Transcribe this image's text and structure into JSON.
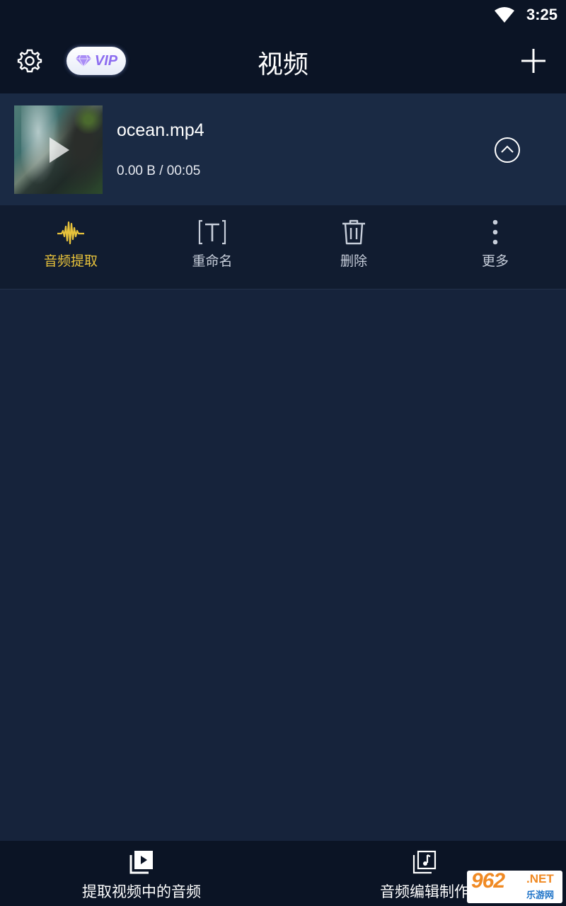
{
  "status": {
    "time": "3:25"
  },
  "header": {
    "title": "视频",
    "vip_label": "VIP"
  },
  "file": {
    "name": "ocean.mp4",
    "info": "0.00 B / 00:05"
  },
  "actions": [
    {
      "label": "音频提取",
      "icon": "audio-wave-icon",
      "active": true
    },
    {
      "label": "重命名",
      "icon": "rename-text-icon",
      "active": false
    },
    {
      "label": "删除",
      "icon": "trash-icon",
      "active": false
    },
    {
      "label": "更多",
      "icon": "more-vertical-icon",
      "active": false
    }
  ],
  "bottom_nav": [
    {
      "label": "提取视频中的音频",
      "icon": "video-library-icon"
    },
    {
      "label": "音频编辑制作",
      "icon": "music-library-icon"
    }
  ],
  "watermark": {
    "number": "962",
    "suffix": ".NET",
    "site": "乐游网"
  },
  "colors": {
    "accent": "#e7c23b",
    "background": "#16233b",
    "bar": "#0b1425"
  }
}
